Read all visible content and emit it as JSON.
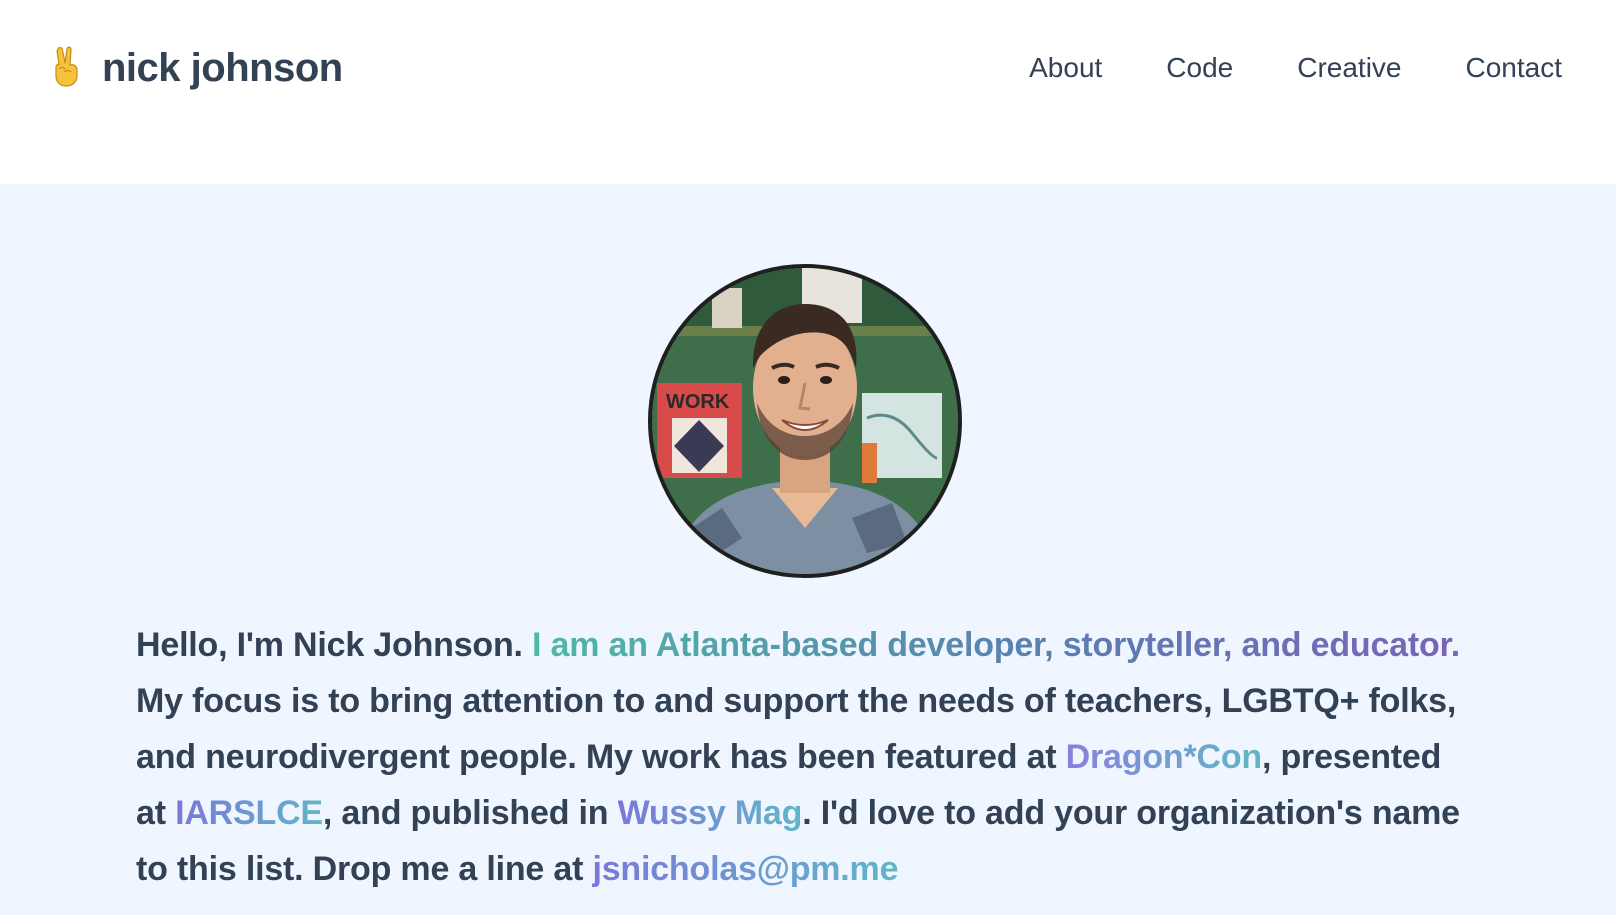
{
  "header": {
    "brand_name": "nick johnson",
    "brand_icon": "peace-hand-icon",
    "nav": [
      {
        "label": "About"
      },
      {
        "label": "Code"
      },
      {
        "label": "Creative"
      },
      {
        "label": "Contact"
      }
    ]
  },
  "hero": {
    "avatar_alt": "Nick Johnson portrait",
    "intro_start": "Hello, I'm Nick Johnson. ",
    "tagline": "I am an Atlanta-based developer, storyteller, and educator.",
    "body_1": " My focus is to bring attention to and support the needs of teachers, LGBTQ+ folks, and neurodivergent people. My work has been featured at ",
    "link_dragoncon": "Dragon*Con",
    "body_2": ", presented at ",
    "link_iarslce": "IARSLCE",
    "body_3": ", and published in ",
    "link_wussy": "Wussy Mag",
    "body_4": ". I'd love to add your organization's name to this list. Drop me a line at ",
    "link_email": "jsnicholas@pm.me"
  },
  "colors": {
    "text": "#334155",
    "page_bg": "#eff6ff",
    "header_bg": "#ffffff",
    "accent_teal": "#4fb8a6",
    "accent_purple": "#7a63b8"
  }
}
